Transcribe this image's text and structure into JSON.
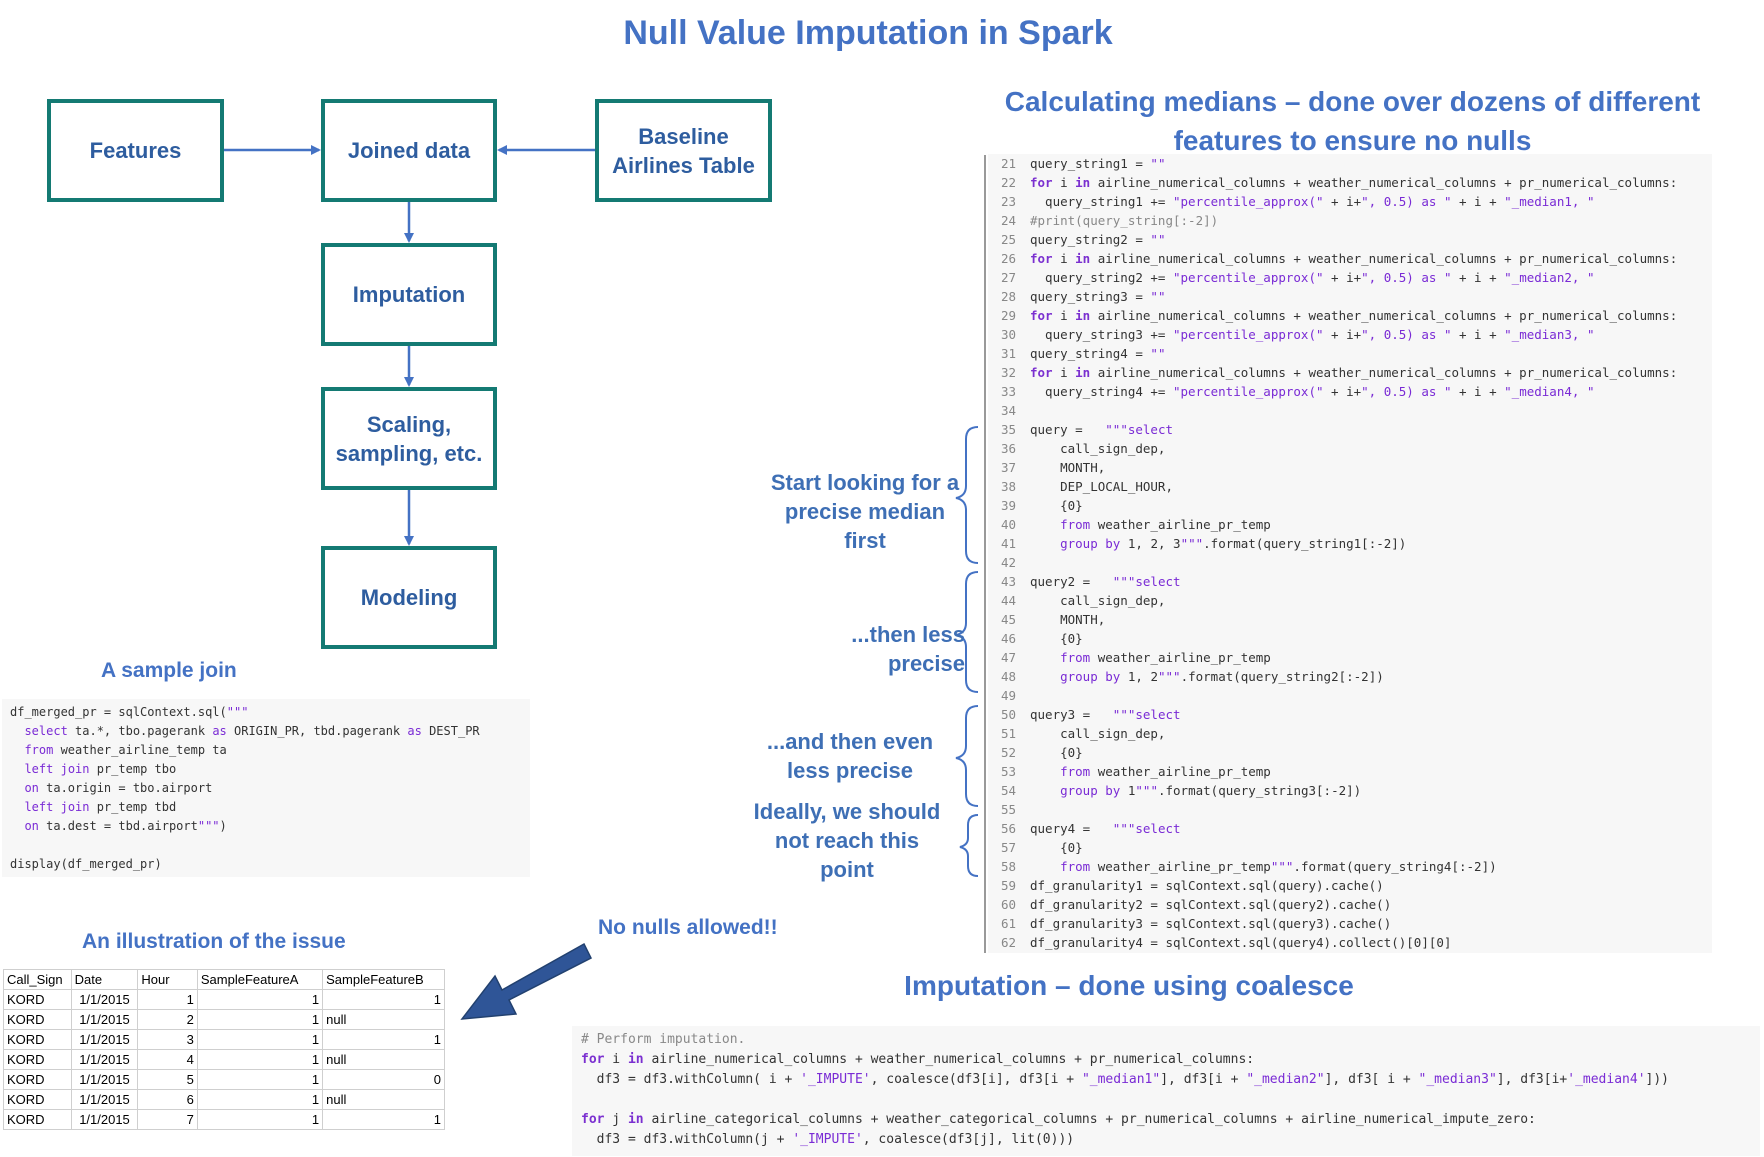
{
  "title": "Null Value Imputation in Spark",
  "flow": {
    "features": "Features",
    "joined": "Joined data",
    "baseline_line1": "Baseline",
    "baseline_line2": "Airlines Table",
    "imputation": "Imputation",
    "scaling_line1": "Scaling,",
    "scaling_line2": "sampling, etc.",
    "modeling": "Modeling"
  },
  "sample_join": {
    "heading": "A sample join",
    "lines": [
      "df_merged_pr = sqlContext.sql(\"\"\"",
      "  select ta.*, tbo.pagerank as ORIGIN_PR, tbd.pagerank as DEST_PR",
      "  from weather_airline_temp ta",
      "  left join pr_temp tbo",
      "  on ta.origin = tbo.airport",
      "  left join pr_temp tbd",
      "  on ta.dest = tbd.airport\"\"\")",
      "",
      "display(df_merged_pr)"
    ]
  },
  "issue": {
    "heading": "An illustration of the issue",
    "callout": "No nulls allowed!!",
    "columns": [
      "Call_Sign",
      "Date",
      "Hour",
      "SampleFeatureA",
      "SampleFeatureB"
    ],
    "rows": [
      [
        "KORD",
        "1/1/2015",
        "1",
        "1",
        "1"
      ],
      [
        "KORD",
        "1/1/2015",
        "2",
        "1",
        "null"
      ],
      [
        "KORD",
        "1/1/2015",
        "3",
        "1",
        "1"
      ],
      [
        "KORD",
        "1/1/2015",
        "4",
        "1",
        "null"
      ],
      [
        "KORD",
        "1/1/2015",
        "5",
        "1",
        "0"
      ],
      [
        "KORD",
        "1/1/2015",
        "6",
        "1",
        "null"
      ],
      [
        "KORD",
        "1/1/2015",
        "7",
        "1",
        "1"
      ]
    ]
  },
  "medians": {
    "heading_line1": "Calculating medians – done over dozens of different",
    "heading_line2": "features to ensure no nulls",
    "notes": {
      "precise": [
        "Start looking for a",
        "precise median",
        "first"
      ],
      "less_precise": [
        "...then less precise"
      ],
      "even_less": [
        "...and then even",
        "less precise"
      ],
      "ideally": [
        "Ideally, we should",
        "not reach this",
        "point"
      ]
    },
    "code": [
      {
        "n": "21",
        "t": "query_string1 = \"\""
      },
      {
        "n": "22",
        "t": "for i in airline_numerical_columns + weather_numerical_columns + pr_numerical_columns:"
      },
      {
        "n": "23",
        "t": "  query_string1 += \"percentile_approx(\" + i+\", 0.5) as \" + i + \"_median1, \""
      },
      {
        "n": "24",
        "t": "#print(query_string[:-2])"
      },
      {
        "n": "25",
        "t": "query_string2 = \"\""
      },
      {
        "n": "26",
        "t": "for i in airline_numerical_columns + weather_numerical_columns + pr_numerical_columns:"
      },
      {
        "n": "27",
        "t": "  query_string2 += \"percentile_approx(\" + i+\", 0.5) as \" + i + \"_median2, \""
      },
      {
        "n": "28",
        "t": "query_string3 = \"\""
      },
      {
        "n": "29",
        "t": "for i in airline_numerical_columns + weather_numerical_columns + pr_numerical_columns:"
      },
      {
        "n": "30",
        "t": "  query_string3 += \"percentile_approx(\" + i+\", 0.5) as \" + i + \"_median3, \""
      },
      {
        "n": "31",
        "t": "query_string4 = \"\""
      },
      {
        "n": "32",
        "t": "for i in airline_numerical_columns + weather_numerical_columns + pr_numerical_columns:"
      },
      {
        "n": "33",
        "t": "  query_string4 += \"percentile_approx(\" + i+\", 0.5) as \" + i + \"_median4, \""
      },
      {
        "n": "34",
        "t": ""
      },
      {
        "n": "35",
        "t": "query =   \"\"\"select"
      },
      {
        "n": "36",
        "t": "    call_sign_dep,"
      },
      {
        "n": "37",
        "t": "    MONTH,"
      },
      {
        "n": "38",
        "t": "    DEP_LOCAL_HOUR,"
      },
      {
        "n": "39",
        "t": "    {0}"
      },
      {
        "n": "40",
        "t": "    from weather_airline_pr_temp"
      },
      {
        "n": "41",
        "t": "    group by 1, 2, 3\"\"\".format(query_string1[:-2])"
      },
      {
        "n": "42",
        "t": ""
      },
      {
        "n": "43",
        "t": "query2 =   \"\"\"select"
      },
      {
        "n": "44",
        "t": "    call_sign_dep,"
      },
      {
        "n": "45",
        "t": "    MONTH,"
      },
      {
        "n": "46",
        "t": "    {0}"
      },
      {
        "n": "47",
        "t": "    from weather_airline_pr_temp"
      },
      {
        "n": "48",
        "t": "    group by 1, 2\"\"\".format(query_string2[:-2])"
      },
      {
        "n": "49",
        "t": ""
      },
      {
        "n": "50",
        "t": "query3 =   \"\"\"select"
      },
      {
        "n": "51",
        "t": "    call_sign_dep,"
      },
      {
        "n": "52",
        "t": "    {0}"
      },
      {
        "n": "53",
        "t": "    from weather_airline_pr_temp"
      },
      {
        "n": "54",
        "t": "    group by 1\"\"\".format(query_string3[:-2])"
      },
      {
        "n": "55",
        "t": ""
      },
      {
        "n": "56",
        "t": "query4 =   \"\"\"select"
      },
      {
        "n": "57",
        "t": "    {0}"
      },
      {
        "n": "58",
        "t": "    from weather_airline_pr_temp\"\"\".format(query_string4[:-2])"
      },
      {
        "n": "59",
        "t": "df_granularity1 = sqlContext.sql(query).cache()"
      },
      {
        "n": "60",
        "t": "df_granularity2 = sqlContext.sql(query2).cache()"
      },
      {
        "n": "61",
        "t": "df_granularity3 = sqlContext.sql(query3).cache()"
      },
      {
        "n": "62",
        "t": "df_granularity4 = sqlContext.sql(query4).collect()[0][0]"
      }
    ]
  },
  "imputation": {
    "heading": "Imputation – done using coalesce",
    "lines": [
      "# Perform imputation.",
      "for i in airline_numerical_columns + weather_numerical_columns + pr_numerical_columns:",
      "  df3 = df3.withColumn( i + '_IMPUTE', coalesce(df3[i], df3[i + \"_median1\"], df3[i + \"_median2\"], df3[ i + \"_median3\"], df3[i+'_median4']))",
      "",
      "for j in airline_categorical_columns + weather_categorical_columns + pr_numerical_columns + airline_numerical_impute_zero:",
      "  df3 = df3.withColumn(j + '_IMPUTE', coalesce(df3[j], lit(0)))"
    ]
  },
  "colors": {
    "title": "#4472c4",
    "box_border": "#147a73",
    "box_text": "#2e5d9f",
    "arrow": "#4472c4",
    "code_keyword": "#7b30d0",
    "code_bg": "#f7f7f7"
  }
}
